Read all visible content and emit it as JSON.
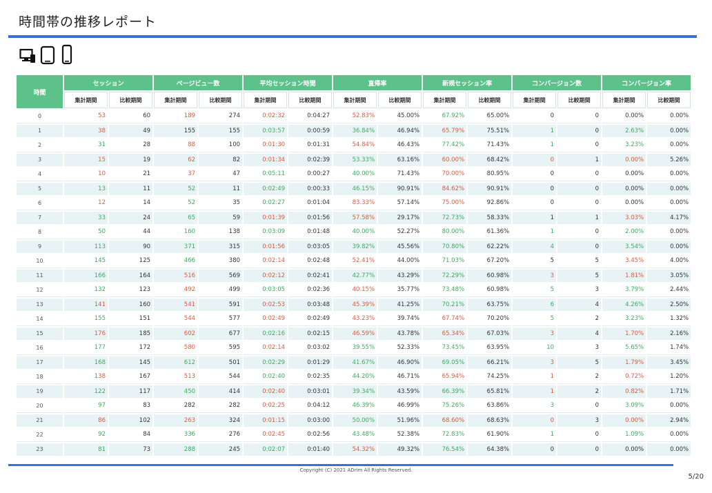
{
  "title": "時間帯の推移レポート",
  "device_icons": [
    "desktop-icon",
    "tablet-icon",
    "smartphone-icon"
  ],
  "header": {
    "hour_label": "時間",
    "groups": [
      "セッション",
      "ページビュー数",
      "平均セッション時間",
      "直帰率",
      "新規セッション率",
      "コンバージョン数",
      "コンバージョン率"
    ],
    "sub_current": "集計期間",
    "sub_compare": "比較期間"
  },
  "colors": {
    "accent": "#5cc28a",
    "rule": "#3a6fd8",
    "up": "#3aae5a",
    "down": "#e0593f"
  },
  "rows": [
    {
      "hour": "0",
      "vals": [
        "53",
        "60",
        "189",
        "274",
        "0:02:32",
        "0:04:27",
        "52.83%",
        "45.00%",
        "67.92%",
        "65.00%",
        "0",
        "0",
        "0.00%",
        "0.00%"
      ],
      "cls": [
        "r",
        "k",
        "r",
        "k",
        "r",
        "k",
        "r",
        "k",
        "g",
        "k",
        "k",
        "k",
        "k",
        "k"
      ]
    },
    {
      "hour": "1",
      "vals": [
        "38",
        "49",
        "155",
        "155",
        "0:03:57",
        "0:00:59",
        "36.84%",
        "46.94%",
        "65.79%",
        "75.51%",
        "1",
        "0",
        "2.63%",
        "0.00%"
      ],
      "cls": [
        "r",
        "k",
        "k",
        "k",
        "g",
        "k",
        "g",
        "k",
        "r",
        "k",
        "g",
        "k",
        "g",
        "k"
      ]
    },
    {
      "hour": "2",
      "vals": [
        "31",
        "28",
        "88",
        "100",
        "0:01:30",
        "0:01:31",
        "54.84%",
        "46.43%",
        "77.42%",
        "71.43%",
        "1",
        "0",
        "3.23%",
        "0.00%"
      ],
      "cls": [
        "g",
        "k",
        "r",
        "k",
        "r",
        "k",
        "r",
        "k",
        "g",
        "k",
        "g",
        "k",
        "g",
        "k"
      ]
    },
    {
      "hour": "3",
      "vals": [
        "15",
        "19",
        "62",
        "82",
        "0:01:34",
        "0:02:39",
        "53.33%",
        "63.16%",
        "60.00%",
        "68.42%",
        "0",
        "1",
        "0.00%",
        "5.26%"
      ],
      "cls": [
        "r",
        "k",
        "r",
        "k",
        "r",
        "k",
        "g",
        "k",
        "r",
        "k",
        "r",
        "k",
        "r",
        "k"
      ]
    },
    {
      "hour": "4",
      "vals": [
        "10",
        "21",
        "37",
        "47",
        "0:05:11",
        "0:00:27",
        "40.00%",
        "71.43%",
        "70.00%",
        "80.95%",
        "0",
        "0",
        "0.00%",
        "0.00%"
      ],
      "cls": [
        "r",
        "k",
        "r",
        "k",
        "g",
        "k",
        "g",
        "k",
        "r",
        "k",
        "k",
        "k",
        "k",
        "k"
      ]
    },
    {
      "hour": "5",
      "vals": [
        "13",
        "11",
        "52",
        "11",
        "0:02:49",
        "0:00:33",
        "46.15%",
        "90.91%",
        "84.62%",
        "90.91%",
        "0",
        "0",
        "0.00%",
        "0.00%"
      ],
      "cls": [
        "g",
        "k",
        "g",
        "k",
        "g",
        "k",
        "g",
        "k",
        "r",
        "k",
        "k",
        "k",
        "k",
        "k"
      ]
    },
    {
      "hour": "6",
      "vals": [
        "12",
        "14",
        "52",
        "35",
        "0:02:27",
        "0:01:04",
        "83.33%",
        "57.14%",
        "75.00%",
        "92.86%",
        "0",
        "0",
        "0.00%",
        "0.00%"
      ],
      "cls": [
        "r",
        "k",
        "g",
        "k",
        "g",
        "k",
        "r",
        "k",
        "r",
        "k",
        "k",
        "k",
        "k",
        "k"
      ]
    },
    {
      "hour": "7",
      "vals": [
        "33",
        "24",
        "65",
        "59",
        "0:01:39",
        "0:01:56",
        "57.58%",
        "29.17%",
        "72.73%",
        "58.33%",
        "1",
        "1",
        "3.03%",
        "4.17%"
      ],
      "cls": [
        "g",
        "k",
        "g",
        "k",
        "r",
        "k",
        "r",
        "k",
        "g",
        "k",
        "k",
        "k",
        "r",
        "k"
      ]
    },
    {
      "hour": "8",
      "vals": [
        "50",
        "44",
        "160",
        "138",
        "0:03:09",
        "0:01:48",
        "40.00%",
        "52.27%",
        "80.00%",
        "61.36%",
        "1",
        "0",
        "2.00%",
        "0.00%"
      ],
      "cls": [
        "g",
        "k",
        "g",
        "k",
        "g",
        "k",
        "g",
        "k",
        "g",
        "k",
        "g",
        "k",
        "g",
        "k"
      ]
    },
    {
      "hour": "9",
      "vals": [
        "113",
        "90",
        "371",
        "315",
        "0:01:56",
        "0:03:05",
        "39.82%",
        "45.56%",
        "70.80%",
        "62.22%",
        "4",
        "0",
        "3.54%",
        "0.00%"
      ],
      "cls": [
        "g",
        "k",
        "g",
        "k",
        "r",
        "k",
        "g",
        "k",
        "g",
        "k",
        "g",
        "k",
        "g",
        "k"
      ]
    },
    {
      "hour": "10",
      "vals": [
        "145",
        "125",
        "466",
        "380",
        "0:02:14",
        "0:02:48",
        "52.41%",
        "44.00%",
        "71.03%",
        "67.20%",
        "5",
        "5",
        "3.45%",
        "4.00%"
      ],
      "cls": [
        "g",
        "k",
        "g",
        "k",
        "r",
        "k",
        "r",
        "k",
        "g",
        "k",
        "k",
        "k",
        "r",
        "k"
      ]
    },
    {
      "hour": "11",
      "vals": [
        "166",
        "164",
        "516",
        "569",
        "0:02:12",
        "0:02:41",
        "42.77%",
        "43.29%",
        "72.29%",
        "60.98%",
        "3",
        "5",
        "1.81%",
        "3.05%"
      ],
      "cls": [
        "g",
        "k",
        "r",
        "k",
        "r",
        "k",
        "g",
        "k",
        "g",
        "k",
        "r",
        "k",
        "r",
        "k"
      ]
    },
    {
      "hour": "12",
      "vals": [
        "132",
        "123",
        "492",
        "499",
        "0:03:05",
        "0:02:36",
        "40.15%",
        "35.77%",
        "73.48%",
        "60.98%",
        "5",
        "3",
        "3.79%",
        "2.44%"
      ],
      "cls": [
        "g",
        "k",
        "r",
        "k",
        "g",
        "k",
        "r",
        "k",
        "g",
        "k",
        "g",
        "k",
        "g",
        "k"
      ]
    },
    {
      "hour": "13",
      "vals": [
        "141",
        "160",
        "541",
        "591",
        "0:02:53",
        "0:03:48",
        "45.39%",
        "41.25%",
        "70.21%",
        "63.75%",
        "6",
        "4",
        "4.26%",
        "2.50%"
      ],
      "cls": [
        "r",
        "k",
        "r",
        "k",
        "r",
        "k",
        "r",
        "k",
        "g",
        "k",
        "g",
        "k",
        "g",
        "k"
      ]
    },
    {
      "hour": "14",
      "vals": [
        "155",
        "151",
        "544",
        "577",
        "0:02:49",
        "0:02:49",
        "43.23%",
        "39.74%",
        "67.74%",
        "70.20%",
        "5",
        "2",
        "3.23%",
        "1.32%"
      ],
      "cls": [
        "g",
        "k",
        "r",
        "k",
        "r",
        "k",
        "r",
        "k",
        "r",
        "k",
        "g",
        "k",
        "g",
        "k"
      ]
    },
    {
      "hour": "15",
      "vals": [
        "176",
        "185",
        "602",
        "677",
        "0:02:16",
        "0:02:15",
        "46.59%",
        "43.78%",
        "65.34%",
        "67.03%",
        "3",
        "4",
        "1.70%",
        "2.16%"
      ],
      "cls": [
        "r",
        "k",
        "r",
        "k",
        "g",
        "k",
        "r",
        "k",
        "r",
        "k",
        "r",
        "k",
        "r",
        "k"
      ]
    },
    {
      "hour": "16",
      "vals": [
        "177",
        "172",
        "580",
        "595",
        "0:02:14",
        "0:03:02",
        "39.55%",
        "52.33%",
        "73.45%",
        "63.95%",
        "10",
        "3",
        "5.65%",
        "1.74%"
      ],
      "cls": [
        "g",
        "k",
        "r",
        "k",
        "r",
        "k",
        "g",
        "k",
        "g",
        "k",
        "g",
        "k",
        "g",
        "k"
      ]
    },
    {
      "hour": "17",
      "vals": [
        "168",
        "145",
        "612",
        "501",
        "0:02:29",
        "0:01:29",
        "41.67%",
        "46.90%",
        "69.05%",
        "66.21%",
        "3",
        "5",
        "1.79%",
        "3.45%"
      ],
      "cls": [
        "g",
        "k",
        "g",
        "k",
        "g",
        "k",
        "g",
        "k",
        "g",
        "k",
        "r",
        "k",
        "r",
        "k"
      ]
    },
    {
      "hour": "18",
      "vals": [
        "138",
        "167",
        "513",
        "544",
        "0:02:40",
        "0:02:35",
        "44.20%",
        "46.71%",
        "65.94%",
        "74.25%",
        "1",
        "2",
        "0.72%",
        "1.20%"
      ],
      "cls": [
        "r",
        "k",
        "r",
        "k",
        "g",
        "k",
        "g",
        "k",
        "r",
        "k",
        "r",
        "k",
        "r",
        "k"
      ]
    },
    {
      "hour": "19",
      "vals": [
        "122",
        "117",
        "450",
        "414",
        "0:02:40",
        "0:03:01",
        "39.34%",
        "43.59%",
        "66.39%",
        "65.81%",
        "1",
        "2",
        "0.82%",
        "1.71%"
      ],
      "cls": [
        "g",
        "k",
        "g",
        "k",
        "r",
        "k",
        "g",
        "k",
        "g",
        "k",
        "r",
        "k",
        "r",
        "k"
      ]
    },
    {
      "hour": "20",
      "vals": [
        "97",
        "83",
        "282",
        "282",
        "0:02:25",
        "0:04:12",
        "46.39%",
        "46.99%",
        "75.26%",
        "63.86%",
        "3",
        "0",
        "3.09%",
        "0.00%"
      ],
      "cls": [
        "g",
        "k",
        "k",
        "k",
        "r",
        "k",
        "g",
        "k",
        "g",
        "k",
        "g",
        "k",
        "g",
        "k"
      ]
    },
    {
      "hour": "21",
      "vals": [
        "86",
        "102",
        "263",
        "324",
        "0:01:15",
        "0:03:00",
        "50.00%",
        "51.96%",
        "68.60%",
        "68.63%",
        "0",
        "3",
        "0.00%",
        "2.94%"
      ],
      "cls": [
        "r",
        "k",
        "r",
        "k",
        "r",
        "k",
        "g",
        "k",
        "r",
        "k",
        "r",
        "k",
        "r",
        "k"
      ]
    },
    {
      "hour": "22",
      "vals": [
        "92",
        "84",
        "336",
        "276",
        "0:02:45",
        "0:02:56",
        "43.48%",
        "52.38%",
        "72.83%",
        "61.90%",
        "1",
        "0",
        "1.09%",
        "0.00%"
      ],
      "cls": [
        "g",
        "k",
        "g",
        "k",
        "r",
        "k",
        "g",
        "k",
        "g",
        "k",
        "g",
        "k",
        "g",
        "k"
      ]
    },
    {
      "hour": "23",
      "vals": [
        "81",
        "73",
        "288",
        "245",
        "0:02:07",
        "0:01:40",
        "54.32%",
        "49.32%",
        "76.54%",
        "64.38%",
        "0",
        "0",
        "0.00%",
        "0.00%"
      ],
      "cls": [
        "g",
        "k",
        "g",
        "k",
        "g",
        "k",
        "r",
        "k",
        "g",
        "k",
        "k",
        "k",
        "k",
        "k"
      ]
    }
  ],
  "footer": {
    "copyright": "Copyright (C) 2021 ADrim All Rights Reserved.",
    "page": "5/20"
  }
}
